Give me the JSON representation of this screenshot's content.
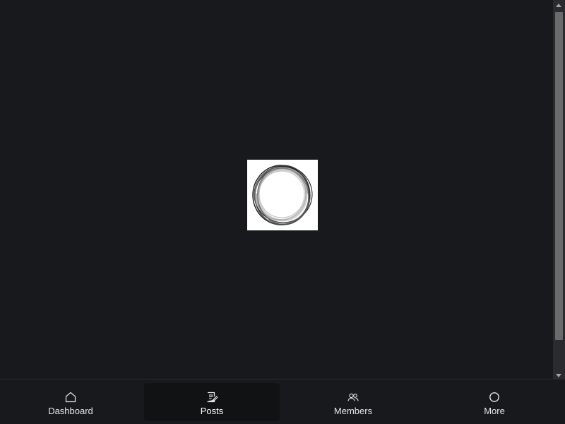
{
  "loader": {
    "icon": "loading-spinner"
  },
  "nav": {
    "items": [
      {
        "label": "Dashboard",
        "icon": "home-icon",
        "active": false
      },
      {
        "label": "Posts",
        "icon": "posts-icon",
        "active": true
      },
      {
        "label": "Members",
        "icon": "members-icon",
        "active": false
      },
      {
        "label": "More",
        "icon": "circle-icon",
        "active": false
      }
    ]
  },
  "colors": {
    "background": "#18191d",
    "active_tab": "#111214",
    "text": "#e6e6e6"
  }
}
